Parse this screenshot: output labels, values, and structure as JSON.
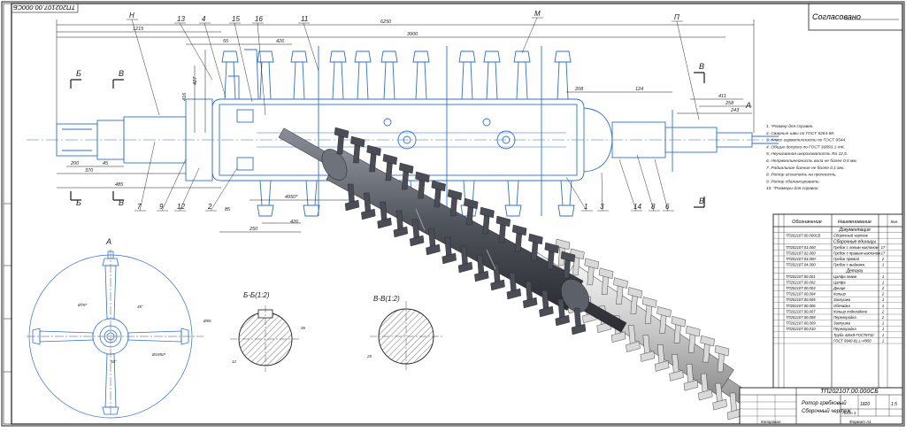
{
  "drawing_code_rotated": "ТП202107.00.000СБ",
  "approval_label": "Согласовано",
  "leaders": [
    "Н",
    "13",
    "4",
    "15",
    "16",
    "11",
    "М",
    "П",
    "7",
    "9",
    "12",
    "2",
    "1",
    "3",
    "14",
    "8",
    "6"
  ],
  "views": {
    "b": "Б",
    "v": "В",
    "a": "А"
  },
  "dimensions": {
    "overall": "6250",
    "d1215": "1215",
    "d3900": "3900",
    "d55": "55",
    "d426": "426",
    "d200": "200",
    "d45": "45",
    "d370": "370",
    "d485": "485",
    "d4950": "4950*",
    "d250": "250",
    "d85": "85",
    "d426b": "426",
    "d208": "208",
    "d124": "124",
    "d411": "411",
    "d258": "258",
    "d243": "243",
    "d416": "416",
    "d427": "427"
  },
  "notes": [
    "1. *Размер для справок.",
    "2. Сварные швы по ГОСТ 5264-80.",
    "3. Класс герметичности по ГОСТ 9544.",
    "4. Общие допуски по ГОСТ 30893.1-mK.",
    "5. Неуказанная шероховатость Ra 12,5.",
    "6. Непрямолинейность вала не более 0,5 мм.",
    "7. Радиальное биение не более 0,1 мм.",
    "8. Ротор испытать на прочность.",
    "9. Ротор сбалансировать.",
    "10. *Размеры для справок."
  ],
  "sections": {
    "bb": "Б-Б(1:2)",
    "vv": "В-В(1:2)",
    "a": "А",
    "dim_bb": "Ø65",
    "dim_vv": "25"
  },
  "spec_table": {
    "headers": [
      "Обозначение",
      "Наименование",
      "Кол."
    ],
    "groups": [
      {
        "title": "Документация",
        "rows": [
          [
            "ТП202107.00.000СБ",
            "Сборочный чертеж",
            ""
          ]
        ]
      },
      {
        "title": "Сборочные единицы",
        "rows": [
          [
            "ТП202107.01.000",
            "Гребок с левым наклоном",
            "17"
          ],
          [
            "ТП202107.02.000",
            "Гребок с правым наклоном",
            "17"
          ],
          [
            "ТП202107.03.000",
            "Гребок прямой",
            "2"
          ],
          [
            "ТП202107.04.000",
            "Гребок с выдвижн.",
            "1"
          ]
        ]
      },
      {
        "title": "Детали",
        "rows": [
          [
            "ТП202107.00.001",
            "Цапфа левая",
            "1"
          ],
          [
            "ТП202107.00.002",
            "Цапфа",
            "1"
          ],
          [
            "ТП202107.00.003",
            "Днище",
            "2"
          ],
          [
            "ТП202107.00.004",
            "Кольцо",
            "2"
          ],
          [
            "ТП202107.00.005",
            "Заглушка",
            "1"
          ],
          [
            "ТП202107.00.006",
            "Обечайка",
            "1"
          ],
          [
            "ТП202107.00.007",
            "Кольцо подкладное",
            "2"
          ],
          [
            "ТП202107.00.008",
            "Перегородка",
            "2"
          ],
          [
            "ТП202107.00.009",
            "Заглушка",
            "1"
          ],
          [
            "ТП202107.00.010",
            "Перегородка",
            "1"
          ],
          [
            "",
            "Труба 426x9-ГОСТ8732",
            "1"
          ],
          [
            "",
            "ГОСТ 9940-81 L=4950",
            "1"
          ]
        ]
      }
    ]
  },
  "title_block": {
    "code": "ТП202107.00.000СБ",
    "name_line1": "Ротор гребковый",
    "name_line2": "Сборочный чертеж",
    "mass": "1820",
    "scale": "1:5",
    "sheet": "Лист 1",
    "copy": "Копировал",
    "format": "Формат A1"
  },
  "colors": {
    "line": "#1b1b1b",
    "blue": "#2f6fd8",
    "model": "#4a4d55",
    "paper": "#ffffff"
  }
}
